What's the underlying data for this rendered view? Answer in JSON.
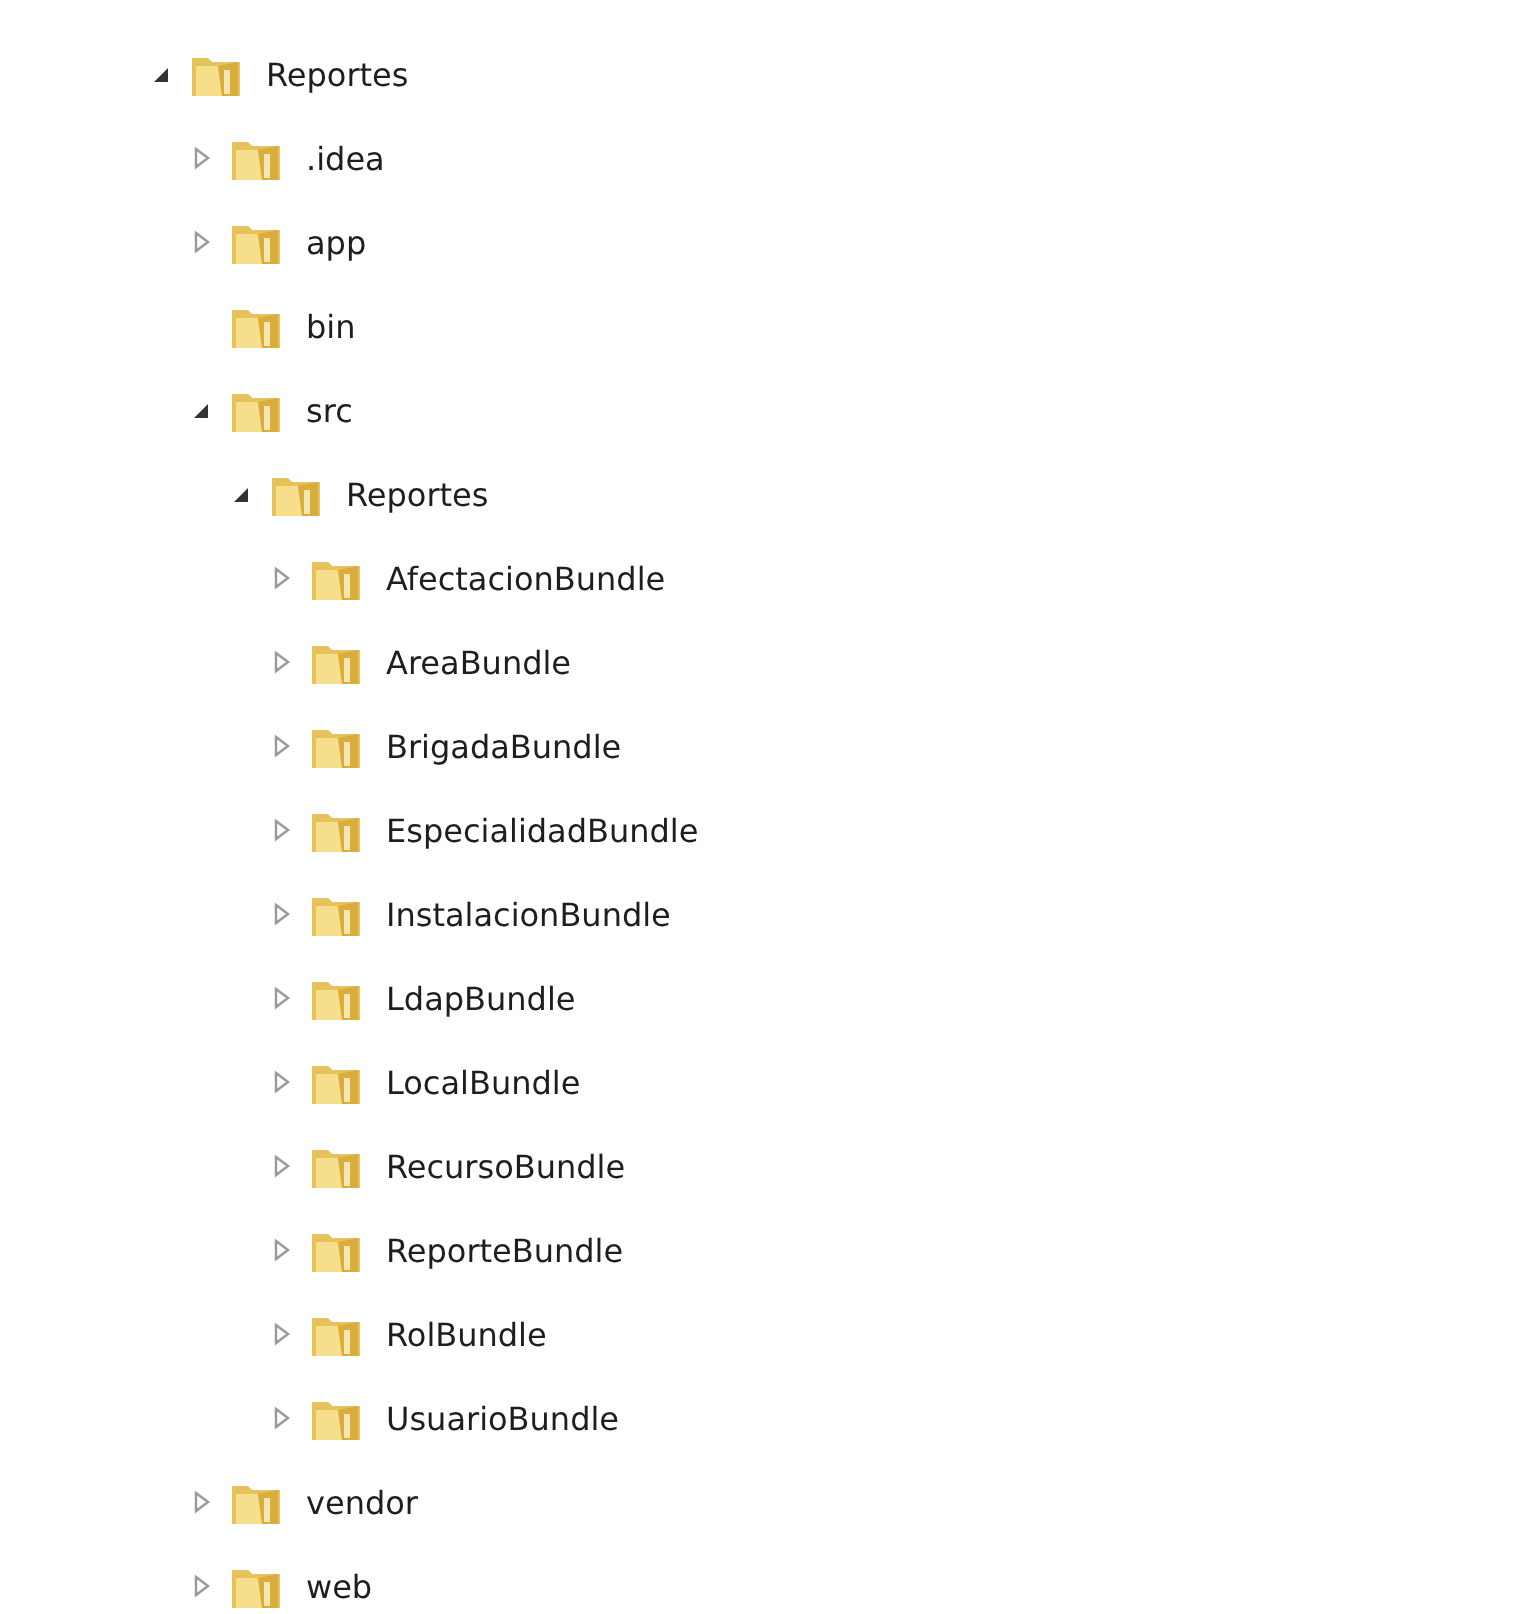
{
  "tree": [
    {
      "label": "Reportes",
      "kind": "branch",
      "expanded": true,
      "children": [
        {
          "label": ".idea",
          "kind": "branch",
          "expanded": false
        },
        {
          "label": "app",
          "kind": "branch",
          "expanded": false
        },
        {
          "label": "bin",
          "kind": "leaf"
        },
        {
          "label": "src",
          "kind": "branch",
          "expanded": true,
          "children": [
            {
              "label": "Reportes",
              "kind": "branch",
              "expanded": true,
              "children": [
                {
                  "label": "AfectacionBundle",
                  "kind": "branch",
                  "expanded": false
                },
                {
                  "label": "AreaBundle",
                  "kind": "branch",
                  "expanded": false
                },
                {
                  "label": "BrigadaBundle",
                  "kind": "branch",
                  "expanded": false
                },
                {
                  "label": "EspecialidadBundle",
                  "kind": "branch",
                  "expanded": false
                },
                {
                  "label": "InstalacionBundle",
                  "kind": "branch",
                  "expanded": false
                },
                {
                  "label": "LdapBundle",
                  "kind": "branch",
                  "expanded": false
                },
                {
                  "label": "LocalBundle",
                  "kind": "branch",
                  "expanded": false
                },
                {
                  "label": "RecursoBundle",
                  "kind": "branch",
                  "expanded": false
                },
                {
                  "label": "ReporteBundle",
                  "kind": "branch",
                  "expanded": false
                },
                {
                  "label": "RolBundle",
                  "kind": "branch",
                  "expanded": false
                },
                {
                  "label": "UsuarioBundle",
                  "kind": "branch",
                  "expanded": false
                }
              ]
            }
          ]
        },
        {
          "label": "vendor",
          "kind": "branch",
          "expanded": false
        },
        {
          "label": "web",
          "kind": "branch",
          "expanded": false
        }
      ]
    }
  ]
}
